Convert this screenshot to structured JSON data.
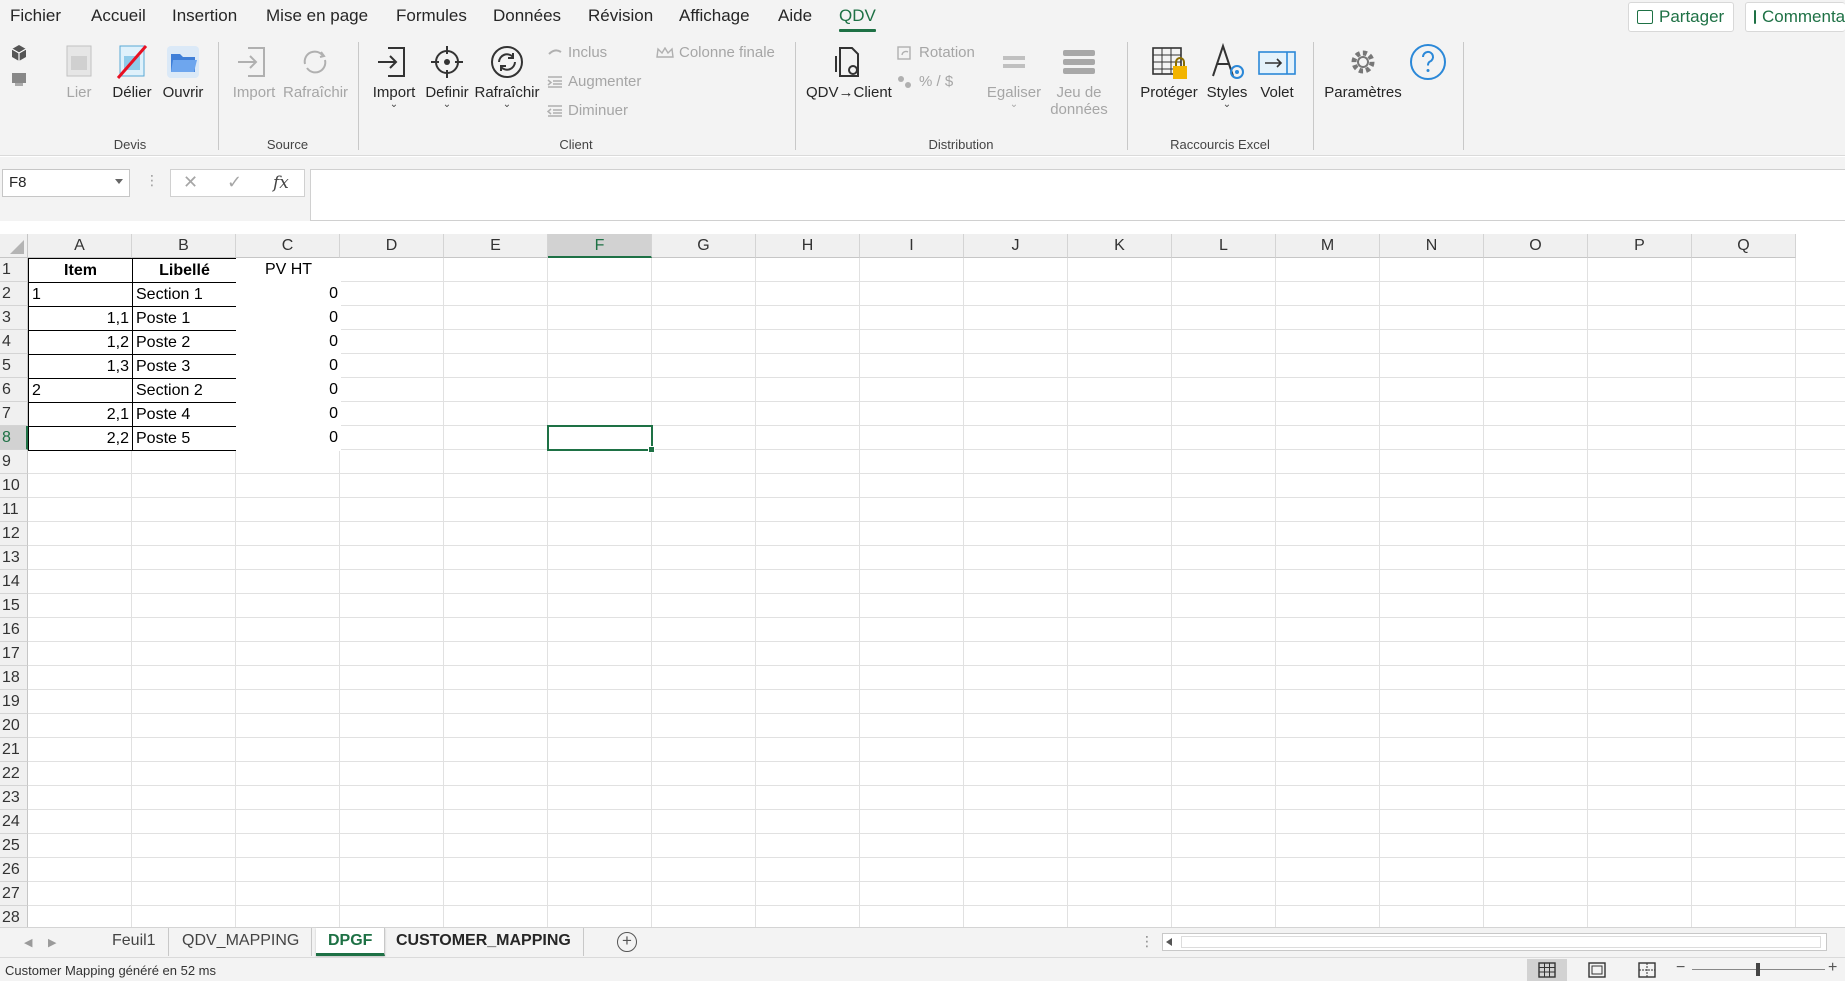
{
  "menu": {
    "tabs": [
      {
        "id": "fichier",
        "label": "Fichier"
      },
      {
        "id": "accueil",
        "label": "Accueil"
      },
      {
        "id": "insertion",
        "label": "Insertion"
      },
      {
        "id": "mise-en-page",
        "label": "Mise en page"
      },
      {
        "id": "formules",
        "label": "Formules"
      },
      {
        "id": "donnees",
        "label": "Données"
      },
      {
        "id": "revision",
        "label": "Révision"
      },
      {
        "id": "affichage",
        "label": "Affichage"
      },
      {
        "id": "aide",
        "label": "Aide"
      },
      {
        "id": "qdv",
        "label": "QDV"
      }
    ],
    "active_tab": "QDV",
    "share_label": "Partager",
    "comments_label": "Commentaires"
  },
  "ribbon": {
    "groups": {
      "devis": "Devis",
      "source": "Source",
      "client": "Client",
      "distribution": "Distribution",
      "raccourcis": "Raccourcis Excel"
    },
    "buttons": {
      "lier": "Lier",
      "delier": "Délier",
      "ouvrir": "Ouvrir",
      "import_source": "Import",
      "rafraichir_source": "Rafraîchir",
      "import_client": "Import",
      "definir": "Definir",
      "rafraichir_client": "Rafraîchir",
      "inclus": "Inclus",
      "augmenter": "Augmenter",
      "diminuer": "Diminuer",
      "colonne_finale": "Colonne finale",
      "qdv_client": "QDV→Client",
      "rotation": "Rotation",
      "percent_dollar": "% / $",
      "egaliser": "Egaliser",
      "jeu_line1": "Jeu de",
      "jeu_line2": "données",
      "proteger": "Protéger",
      "styles": "Styles",
      "volet": "Volet",
      "parametres": "Paramètres"
    },
    "colors": {
      "accent": "#1e7145",
      "link_blue": "#2b88d8",
      "disabled": "#a6a6a6"
    }
  },
  "formula_bar": {
    "name_box": "F8",
    "formula": "",
    "fx_label": "fx"
  },
  "grid": {
    "columns": [
      "A",
      "B",
      "C",
      "D",
      "E",
      "F",
      "G",
      "H",
      "I",
      "J",
      "K",
      "L",
      "M",
      "N",
      "O",
      "P",
      "Q"
    ],
    "rows": [
      "1",
      "2",
      "3",
      "4",
      "5",
      "6",
      "7",
      "8",
      "9",
      "10",
      "11",
      "12",
      "13",
      "14",
      "15",
      "16",
      "17",
      "18",
      "19",
      "20",
      "21",
      "22",
      "23",
      "24",
      "25",
      "26",
      "27",
      "28"
    ],
    "selected_col": "F",
    "selected_row": "8",
    "headers": {
      "item": "Item",
      "libelle": "Libellé",
      "pv_ht": "PV HT"
    },
    "data_rows": [
      {
        "item": "1",
        "libelle": "Section 1",
        "pv": "0",
        "kind": "section"
      },
      {
        "item": "1,1",
        "libelle": "Poste 1",
        "pv": "0",
        "kind": "poste"
      },
      {
        "item": "1,2",
        "libelle": "Poste 2",
        "pv": "0",
        "kind": "poste"
      },
      {
        "item": "1,3",
        "libelle": "Poste 3",
        "pv": "0",
        "kind": "poste"
      },
      {
        "item": "2",
        "libelle": "Section 2",
        "pv": "0",
        "kind": "section"
      },
      {
        "item": "2,1",
        "libelle": "Poste 4",
        "pv": "0",
        "kind": "poste"
      },
      {
        "item": "2,2",
        "libelle": "Poste 5",
        "pv": "0",
        "kind": "poste"
      }
    ]
  },
  "sheets": {
    "tabs": [
      "Feuil1",
      "QDV_MAPPING",
      "DPGF",
      "CUSTOMER_MAPPING"
    ],
    "active": "DPGF",
    "add_label": "+"
  },
  "status": {
    "text": "Customer Mapping généré en 52 ms",
    "zoom_minus": "−",
    "zoom_plus": "+"
  }
}
